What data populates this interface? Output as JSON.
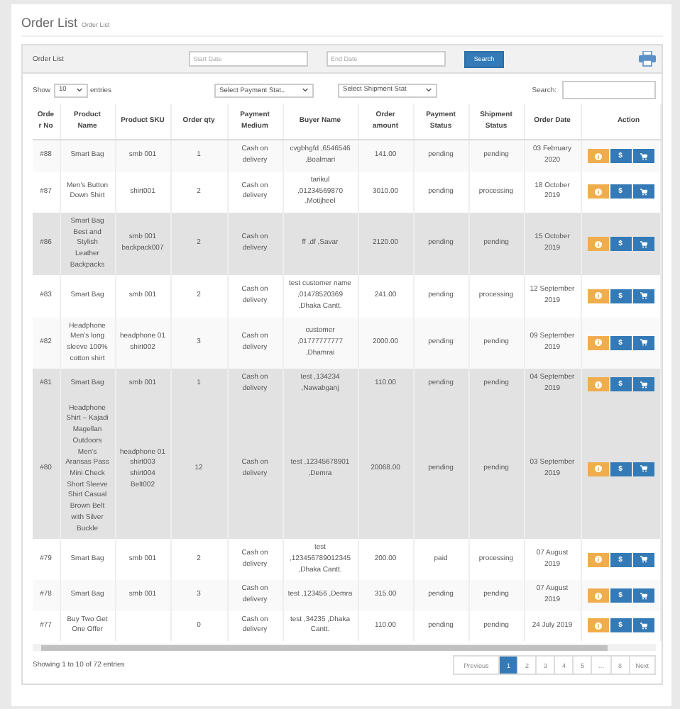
{
  "page": {
    "title": "Order List",
    "subtitle": "Order List"
  },
  "panel": {
    "title": "Order List",
    "start_date": {
      "placeholder": "Start Date"
    },
    "end_date": {
      "placeholder": "End Date"
    },
    "search_button": "Search"
  },
  "controls": {
    "show_label": "Show",
    "page_size": "10",
    "entries_label": "entries",
    "payment_filter": "Select Payment Stat‥",
    "shipment_filter": "Select Shipment Stat",
    "search_label": "Search:"
  },
  "table": {
    "columns": [
      "Order No",
      "Product Name",
      "Product SKU",
      "Order qty",
      "Payment Medium",
      "Buyer Name",
      "Order amount",
      "Payment Status",
      "Shipment Status",
      "Order Date",
      "Action"
    ],
    "rows": [
      {
        "cells": [
          "#88",
          "Smart Bag",
          "smb 001",
          "1",
          "Cash on delivery",
          "cvgbhgfd ,6546546 ,Boalmari",
          "141.00",
          "pending",
          "pending",
          "03 February 2020"
        ],
        "highlighted": false,
        "pay_button": "$"
      },
      {
        "cells": [
          "#87",
          "Men's Button Down Shirt",
          "shirt001",
          "2",
          "Cash on delivery",
          "tarikul ,01234569870 ,Motijheel",
          "3010.00",
          "pending",
          "processing",
          "18 October 2019"
        ],
        "highlighted": false,
        "pay_button": "$"
      },
      {
        "cells": [
          "#86",
          "Smart Bag Best and Stylish Leather Backpacks",
          "smb 001 backpack007",
          "2",
          "Cash on delivery",
          "ff ,df ,Savar",
          "2120.00",
          "pending",
          "pending",
          "15 October 2019"
        ],
        "highlighted": true,
        "pay_button": "$"
      },
      {
        "cells": [
          "#83",
          "Smart Bag",
          "smb 001",
          "2",
          "Cash on delivery",
          "test customer name ,01478520369 ,Dhaka Cantt.",
          "241.00",
          "pending",
          "processing",
          "12 September 2019"
        ],
        "highlighted": false,
        "pay_button": "$"
      },
      {
        "cells": [
          "#82",
          "Headphone Men's long sleeve 100% cotton shirt",
          "headphone 01 shirt002",
          "3",
          "Cash on delivery",
          "customer ,01777777777 ,Dhamrai",
          "2000.00",
          "pending",
          "pending",
          "09 September 2019"
        ],
        "highlighted": false,
        "pay_button": "$"
      },
      {
        "cells": [
          "#81",
          "Smart Bag",
          "smb 001",
          "1",
          "Cash on delivery",
          "test ,134234 ,Nawabganj",
          "110.00",
          "pending",
          "pending",
          "04 September 2019"
        ],
        "highlighted": true,
        "pay_button": "$"
      },
      {
        "cells": [
          "#80",
          "Headphone Shirt – Kajadi Magellan Outdoors Men's Aransas Pass Mini Check Short Sleeve Shirt Casual Brown Belt with Silver Buckle",
          "headphone 01 shirt003 shirt004 Belt002",
          "12",
          "Cash on delivery",
          "test ,12345678901 ,Demra",
          "20068.00",
          "pending",
          "pending",
          "03 September 2019"
        ],
        "highlighted": true,
        "pay_button": "$"
      },
      {
        "cells": [
          "#79",
          "Smart Bag",
          "smb 001",
          "2",
          "Cash on delivery",
          "test ,123456789012345 ,Dhaka Cantt.",
          "200.00",
          "paid",
          "processing",
          "07 August 2019"
        ],
        "highlighted": false,
        "pay_button": "$"
      },
      {
        "cells": [
          "#78",
          "Smart Bag",
          "smb 001",
          "3",
          "Cash on delivery",
          "test ,123456 ,Demra",
          "315.00",
          "pending",
          "pending",
          "07 August 2019"
        ],
        "highlighted": false,
        "pay_button": "$"
      },
      {
        "cells": [
          "#77",
          "Buy Two Get One Offer",
          "",
          "0",
          "Cash on delivery",
          "test ,34235 ,Dhaka Cantt.",
          "110.00",
          "pending",
          "pending",
          "24 July 2019"
        ],
        "highlighted": false,
        "pay_button": "$"
      }
    ]
  },
  "footer": {
    "info": "Showing 1 to 10 of 72 entries",
    "pagination": [
      {
        "label": "Previous",
        "selected": false
      },
      {
        "label": "1",
        "selected": true
      },
      {
        "label": "2",
        "selected": false
      },
      {
        "label": "3",
        "selected": false
      },
      {
        "label": "4",
        "selected": false
      },
      {
        "label": "5",
        "selected": false
      },
      {
        "label": "…",
        "selected": false
      },
      {
        "label": "8",
        "selected": false
      },
      {
        "label": "Next",
        "selected": false
      }
    ]
  }
}
